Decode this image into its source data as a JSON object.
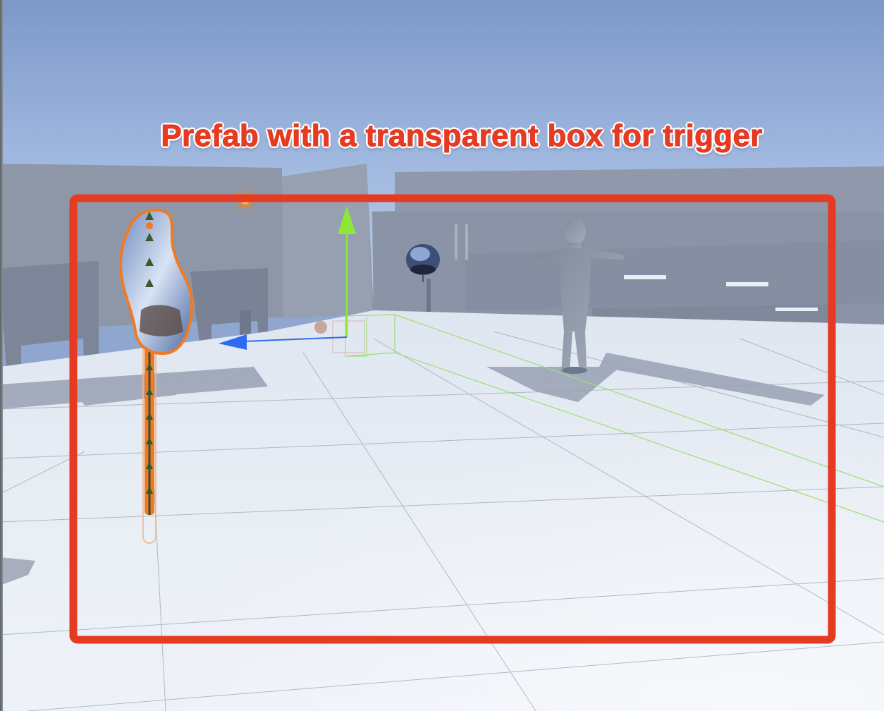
{
  "scene_view": {
    "annotation_text": "Prefab with a transparent box for trigger",
    "annotation_color": "#e53b22",
    "highlight_box_color": "#e53b22",
    "selection_outline_color": "#f07a24",
    "gizmo_colors": {
      "y_axis": "#8ee63a",
      "z_axis": "#2f6bf2",
      "collider_wireframe": "#9be072"
    },
    "sky_colors": [
      "#7f9acb",
      "#a9bfe0"
    ],
    "floor_color": "#e8eef6"
  },
  "icons": {
    "light_gizmo": "sun-light-icon",
    "move_handle_y": "arrow-up-icon",
    "move_handle_z": "arrow-left-icon"
  }
}
